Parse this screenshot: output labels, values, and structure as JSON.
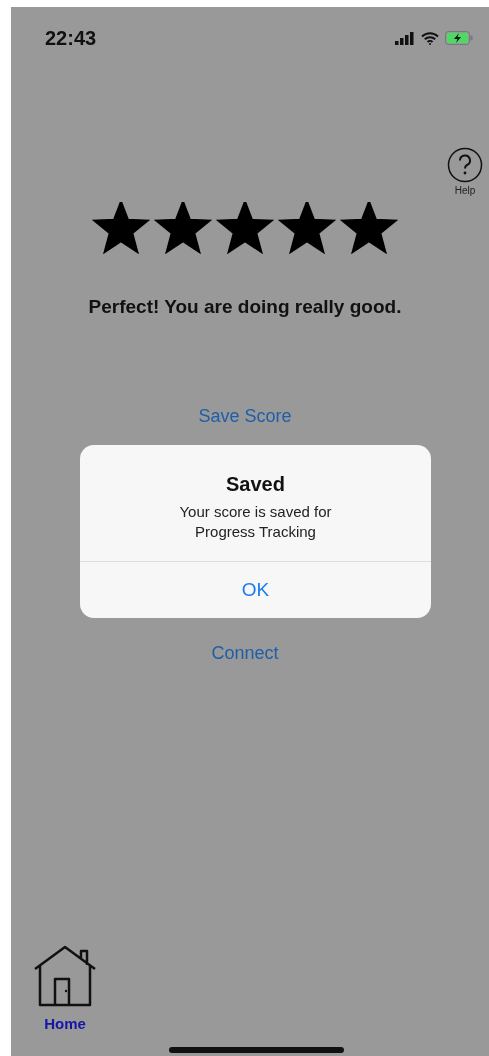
{
  "status_bar": {
    "time": "22:43"
  },
  "help": {
    "label": "Help"
  },
  "rating": {
    "stars": 5
  },
  "message": "Perfect! You are doing really good.",
  "actions": [
    "Save Score",
    "Connect"
  ],
  "alert": {
    "title": "Saved",
    "message": "Your score is saved for Progress Tracking",
    "button": "OK"
  },
  "tab_bar": {
    "items": [
      {
        "label": "Home",
        "selected": true
      }
    ]
  }
}
